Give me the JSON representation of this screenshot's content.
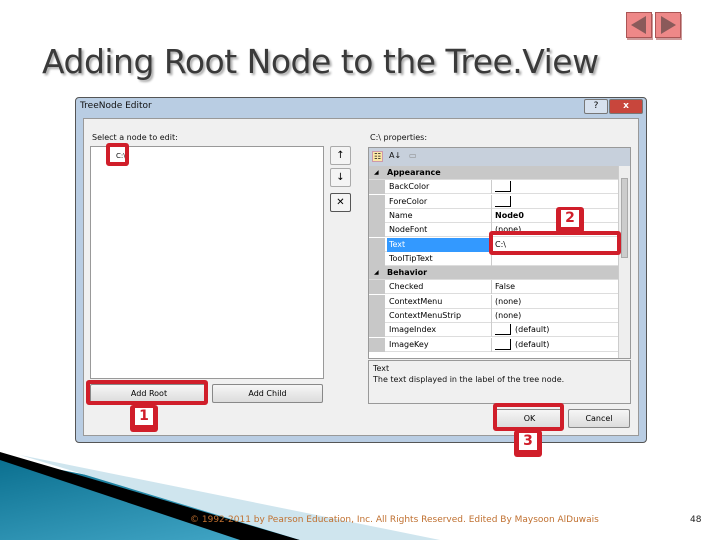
{
  "slide": {
    "title": "Adding Root Node to the Tree.View",
    "footer": "© 1992-2011 by Pearson Education, Inc. All Rights Reserved. Edited By Maysoon AlDuwais",
    "page_number": "48",
    "nav": [
      "previous-slide",
      "next-slide"
    ]
  },
  "dialog": {
    "title": "TreeNode Editor",
    "help": "?",
    "close": "x",
    "tree_label": "Select a node to edit:",
    "node": "C:\\",
    "move_up": "↑",
    "move_down": "↓",
    "delete": "✕",
    "add_root": "Add Root",
    "add_child": "Add Child",
    "props_label": "C:\\ properties:",
    "toolbar": {
      "categorized": "☷",
      "alphabetical": "A↓",
      "pages": "▭"
    },
    "categories": [
      {
        "name": "Appearance",
        "rows": [
          {
            "name": "BackColor",
            "value": ""
          },
          {
            "name": "ForeColor",
            "value": ""
          },
          {
            "name": "Name",
            "value": "Node0"
          },
          {
            "name": "NodeFont",
            "value": "(none)"
          },
          {
            "name": "Text",
            "value": "C:\\"
          },
          {
            "name": "ToolTipText",
            "value": ""
          }
        ]
      },
      {
        "name": "Behavior",
        "rows": [
          {
            "name": "Checked",
            "value": "False"
          },
          {
            "name": "ContextMenu",
            "value": "(none)"
          },
          {
            "name": "ContextMenuStrip",
            "value": "(none)"
          },
          {
            "name": "ImageIndex",
            "value": "(default)"
          },
          {
            "name": "ImageKey",
            "value": "(default)"
          }
        ]
      }
    ],
    "desc_title": "Text",
    "desc_text": "The text displayed in the label of the tree node.",
    "ok": "OK",
    "cancel": "Cancel"
  },
  "callouts": [
    "1",
    "2",
    "3"
  ],
  "colors": {
    "callout": "#d01e2a",
    "selection": "#3399ff"
  }
}
